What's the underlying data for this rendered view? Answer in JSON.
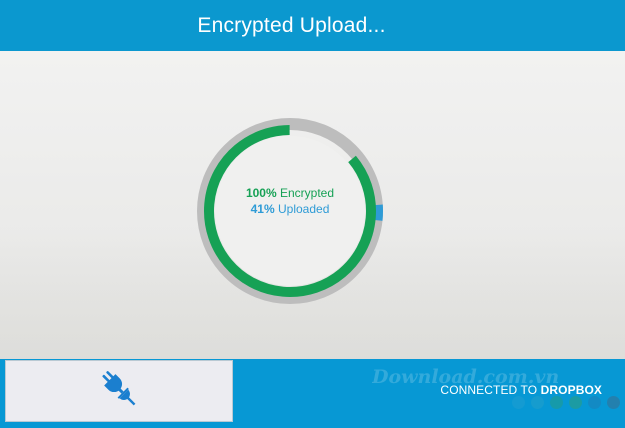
{
  "header": {
    "title": "Encrypted Upload..."
  },
  "progress": {
    "encrypted_value": "100%",
    "encrypted_label": " Encrypted",
    "uploaded_value": "41%",
    "uploaded_label": " Uploaded",
    "encrypted_fraction": 1.0,
    "uploaded_fraction": 0.41
  },
  "footer": {
    "status_prefix": "CONNECTED TO ",
    "status_service": "DROPBOX",
    "watermark": "Download.com.vn",
    "dot_colors": [
      "#1f9fd0",
      "#23a0c9",
      "#239c86",
      "#2e9e7a",
      "#1d7fb7",
      "#3b6d8e"
    ]
  },
  "colors": {
    "header": "#0b98cf",
    "encrypted": "#16a155",
    "uploaded": "#2e9bd6",
    "track": "#bdbdbd"
  },
  "icons": {
    "plug": "unplug-icon"
  }
}
